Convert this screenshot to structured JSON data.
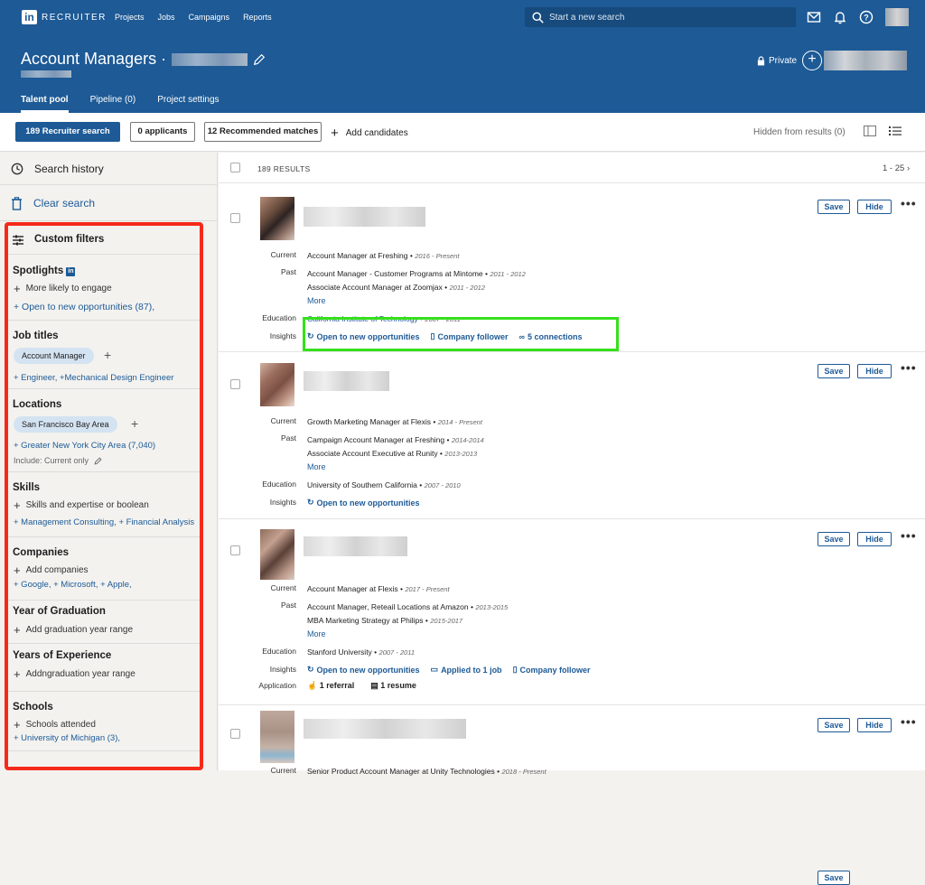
{
  "app": {
    "logo_letters": "in",
    "logo_text": "RECRUITER"
  },
  "nav": [
    "Projects",
    "Jobs",
    "Campaigns",
    "Reports"
  ],
  "search": {
    "placeholder": "Start a new search"
  },
  "project": {
    "title": "Account Managers ·",
    "privacy": "Private"
  },
  "tabs": [
    "Talent pool",
    "Pipeline (0)",
    "Project settings"
  ],
  "actions": {
    "recruiter_search": "189 Recruiter search",
    "applicants": "0 applicants",
    "recommended": "12 Recommended matches",
    "add_candidates": "Add candidates",
    "hidden": "Hidden from results (0)"
  },
  "sidebar": {
    "search_history": "Search history",
    "clear_search": "Clear search",
    "custom_filters": "Custom filters",
    "spotlights": {
      "title": "Spotlights",
      "add": "More likely to engage",
      "link": "+ Open to new opportunities (87),"
    },
    "job_titles": {
      "title": "Job titles",
      "pill": "Account Manager",
      "link": "+ Engineer, +Mechanical Design Engineer"
    },
    "locations": {
      "title": "Locations",
      "pill": "San Francisco Bay Area",
      "link": "+ Greater New York City Area (7,040)",
      "include": "Include: Current only"
    },
    "skills": {
      "title": "Skills",
      "add": "Skills and expertise or boolean",
      "link": "+ Management Consulting, + Financial Analysis"
    },
    "companies": {
      "title": "Companies",
      "add": "Add companies",
      "link": "+ Google, + Microsoft, + Apple,"
    },
    "graduation": {
      "title": "Year of Graduation",
      "add": "Add graduation year range"
    },
    "experience": {
      "title": "Years of Experience",
      "add": "Addngraduation year range"
    },
    "schools": {
      "title": "Schools",
      "add": "Schools attended",
      "link": "+ University of Michigan (3),"
    }
  },
  "results": {
    "count": "189 RESULTS",
    "range": "1 - 25"
  },
  "labels": {
    "current": "Current",
    "past": "Past",
    "education": "Education",
    "insights": "Insights",
    "application": "Application",
    "more": "More",
    "save": "Save",
    "hide": "Hide"
  },
  "cards": [
    {
      "current": "Account Manager at Freshing •",
      "current_dates": "2016 - Present",
      "past1": "Account Manager - Customer Programs at Mintome •",
      "past1_dates": "2011 - 2012",
      "past2": "Associate Account Manager at Zoomjax •",
      "past2_dates": "2011 - 2012",
      "education": "California Institute of Technology •",
      "education_dates": "2007 - 2011",
      "insights": [
        "Open to new opportunities",
        "Company follower",
        "5 connections"
      ]
    },
    {
      "current": "Growth Marketing Manager at Flexis •",
      "current_dates": "2014 - Present",
      "past1": "Campaign Account Manager at Freshing •",
      "past1_dates": "2014-2014",
      "past2": "Associate Account Executive at Runity •",
      "past2_dates": "2013-2013",
      "education": "University of Southern California •",
      "education_dates": "2007 - 2010",
      "insights": [
        "Open to new opportunities"
      ]
    },
    {
      "current": "Account Manager at Flexis •",
      "current_dates": "2017 - Present",
      "past1": "Account Manager, Reteail Locations at Amazon •",
      "past1_dates": "2013-2015",
      "past2": "MBA Marketing Strategy at Philips •",
      "past2_dates": "2015-2017",
      "education": "Stanford University •",
      "education_dates": "2007 - 2011",
      "insights": [
        "Open to new opportunities",
        "Applied to 1 job",
        "Company follower"
      ],
      "application": [
        "1 referral",
        "1 resume"
      ]
    },
    {
      "current": "Senior Product Account Manager at Unity Technologies •",
      "current_dates": "2018 - Present"
    }
  ],
  "colors": {
    "brand": "#1d5a96",
    "highlight_red": "#f52a1a",
    "highlight_green": "#35e01c"
  }
}
